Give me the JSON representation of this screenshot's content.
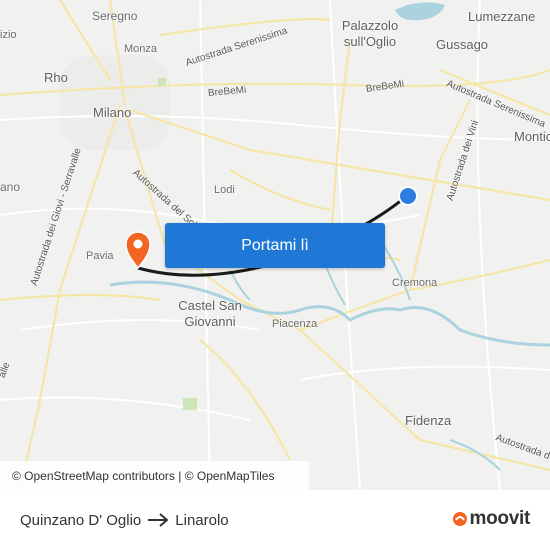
{
  "map": {
    "places": {
      "seregno": "Seregno",
      "monza": "Monza",
      "rho": "Rho",
      "milano": "Milano",
      "lodi": "Lodi",
      "pavia": "Pavia",
      "castel_san_giovanni": "Castel San Giovanni",
      "piacenza": "Piacenza",
      "cremona": "Cremona",
      "fidenza": "Fidenza",
      "palazzolo": "Palazzolo sull'Oglio",
      "gussago": "Gussago",
      "lumezzane": "Lumezzane",
      "montic": "Montic",
      "izio": "izio",
      "ano": "ano"
    },
    "roads": {
      "serenissima_north": "Autostrada Serenissima",
      "serenissima_east": "Autostrada Serenissima",
      "brebemi_1": "BreBeMi",
      "brebemi_2": "BreBeMi",
      "del_sole": "Autostrada del Sole",
      "dei_vini": "Autostrada dei Vini",
      "giovi": "Autostrada dei Giovi - Serravalle",
      "east_bottom": "Autostrada d",
      "west_bottom": "alle"
    },
    "origin_color": "#2f7de1",
    "destination_color": "#f26522",
    "route_color": "#1a1a1a"
  },
  "cta": {
    "label": "Portami lì"
  },
  "attribution": {
    "text": "© OpenStreetMap contributors | © OpenMapTiles"
  },
  "footer": {
    "origin": "Quinzano D' Oglio",
    "destination": "Linarolo",
    "brand": "moovit",
    "brand_color": "#f26522"
  }
}
